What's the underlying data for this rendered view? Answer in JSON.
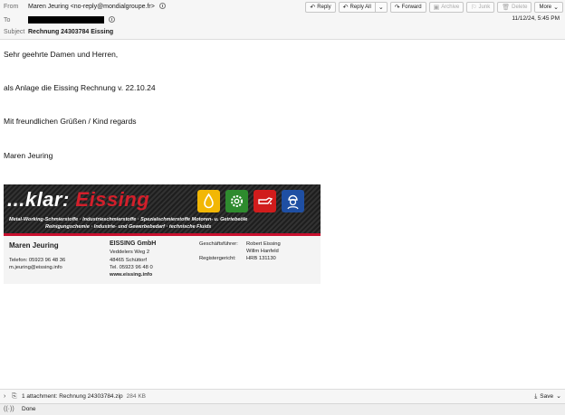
{
  "header": {
    "from_label": "From",
    "from_value": "Maren Jeuring <no-reply@mondialgroupe.fr>",
    "to_label": "To",
    "subject_label": "Subject",
    "subject_value": "Rechnung 24303784 Eissing",
    "date": "11/12/24, 5:45 PM"
  },
  "toolbar": {
    "reply": "Reply",
    "reply_all": "Reply All",
    "forward": "Forward",
    "archive": "Archive",
    "junk": "Junk",
    "delete": "Delete",
    "more": "More"
  },
  "body": {
    "greeting": "Sehr geehrte Damen und Herren,",
    "line1": "als Anlage die Eissing Rechnung v. 22.10.24",
    "closing": "Mit freundlichen Grüßen / Kind regards",
    "name": "Maren Jeuring"
  },
  "signature": {
    "logo_prefix": "...klar: ",
    "logo_brand": "Eissing",
    "tagline1": "Metal-Working-Schmierstoffe · Industrieschmierstoffe · Spezialschmierstoffe Motoren- u. Getriebeöle",
    "tagline2": "Reinigungschemie · Industrie- und Gewerbebedarf · technische Fluids",
    "person": "Maren Jeuring",
    "phone": "Telefon: 05923 96 48 36",
    "email": "m.jeuring@eissing.info",
    "company": "EISSING GmbH",
    "street": "Veddelers Weg 2",
    "city": "48465 Schüttorf",
    "tel": "Tel. 05923 96 48 0",
    "web": "www.eissing.info",
    "gf_label": "Geschäftsführer:",
    "gf1": "Robert Eissing",
    "gf2": "Willm Hanfeld",
    "reg_label": "Registergericht:",
    "reg_value": "HRB 131130"
  },
  "attachment": {
    "text": "1 attachment: Rechnung 24303784.zip",
    "size": "284 KB",
    "save": "Save"
  },
  "status": {
    "text": "Done"
  },
  "colors": {
    "brand_red": "#d31f2b",
    "banner_dark": "#2a2a2a"
  }
}
